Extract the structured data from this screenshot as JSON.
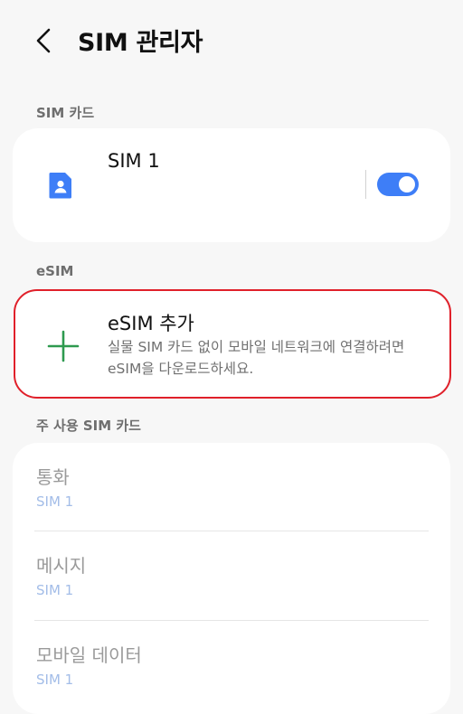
{
  "header": {
    "title": "SIM 관리자"
  },
  "sections": {
    "sim_cards": "SIM 카드",
    "esim": "eSIM",
    "primary_sim": "주 사용 SIM 카드"
  },
  "sim_card": {
    "label": "SIM 1",
    "enabled": true
  },
  "esim_add": {
    "title": "eSIM 추가",
    "description": "실물 SIM 카드 없이 모바일 네트워크에 연결하려면 eSIM을 다운로드하세요."
  },
  "primary_sim": {
    "rows": [
      {
        "title": "통화",
        "value": "SIM 1"
      },
      {
        "title": "메시지",
        "value": "SIM 1"
      },
      {
        "title": "모바일 데이터",
        "value": "SIM 1"
      }
    ]
  },
  "colors": {
    "accent": "#3e7ef7",
    "plus": "#2e9a4f",
    "highlight_outline": "#e0202a",
    "disabled_value": "#a3bde8"
  }
}
